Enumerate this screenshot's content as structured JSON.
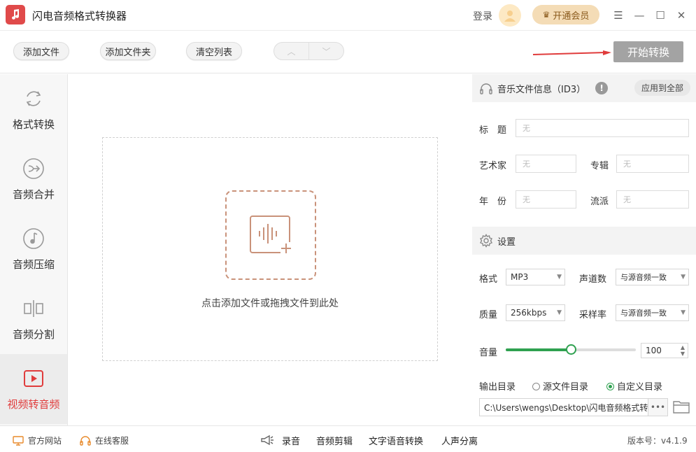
{
  "app": {
    "title": "闪电音频格式转换器",
    "accent": "#e04a4a"
  },
  "header": {
    "login": "登录",
    "vip_label": "开通会员"
  },
  "toolbar": {
    "add_file": "添加文件",
    "add_folder": "添加文件夹",
    "clear_list": "清空列表",
    "start": "开始转换"
  },
  "sidebar": {
    "items": [
      {
        "label": "格式转换",
        "icon": "refresh-icon"
      },
      {
        "label": "音频合并",
        "icon": "merge-icon"
      },
      {
        "label": "音频压缩",
        "icon": "music-note-icon"
      },
      {
        "label": "音频分割",
        "icon": "split-icon"
      },
      {
        "label": "视频转音频",
        "icon": "video-play-icon",
        "active": true
      }
    ]
  },
  "main": {
    "drop_hint": "点击添加文件或拖拽文件到此处"
  },
  "id3": {
    "section_title": "音乐文件信息（ID3）",
    "apply_all": "应用到全部",
    "title_label": "标　题",
    "artist_label": "艺术家",
    "album_label": "专辑",
    "year_label": "年　份",
    "genre_label": "流派",
    "placeholder": "无"
  },
  "settings": {
    "section_title": "设置",
    "format_label": "格式",
    "format_value": "MP3",
    "channels_label": "声道数",
    "channels_value": "与源音频一致",
    "quality_label": "质量",
    "quality_value": "256kbps",
    "samplerate_label": "采样率",
    "samplerate_value": "与源音频一致",
    "volume_label": "音量",
    "volume_value": "100",
    "volume_fraction": 0.5,
    "output_label": "输出目录",
    "output_option_source": "源文件目录",
    "output_option_custom": "自定义目录",
    "output_selected": "custom",
    "output_path": "C:\\Users\\wengs\\Desktop\\闪电音频格式转"
  },
  "statusbar": {
    "website": "官方网站",
    "support": "在线客服",
    "record": "录音",
    "audio_edit": "音频剪辑",
    "tts": "文字语音转换",
    "vocal_split": "人声分离",
    "version": "版本号：v4.1.9"
  },
  "colors": {
    "green": "#2fa150",
    "start_btn": "#a3a3a3",
    "arrow": "#e03c3c"
  }
}
